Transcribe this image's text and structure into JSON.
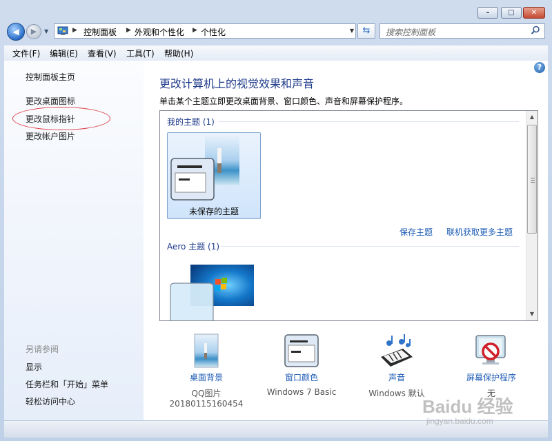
{
  "window": {
    "minimize_glyph": "–",
    "maximize_glyph": "□",
    "close_glyph": "✕"
  },
  "nav": {
    "back_glyph": "◀",
    "forward_glyph": "▶",
    "breadcrumbs": [
      "控制面板",
      "外观和个性化",
      "个性化"
    ],
    "search_placeholder": "搜索控制面板"
  },
  "menu": [
    "文件(F)",
    "编辑(E)",
    "查看(V)",
    "工具(T)",
    "帮助(H)"
  ],
  "sidebar": {
    "links": [
      "控制面板主页",
      "更改桌面图标",
      "更改鼠标指针",
      "更改帐户图片"
    ],
    "see_also_heading": "另请参阅",
    "see_also": [
      "显示",
      "任务栏和「开始」菜单",
      "轻松访问中心"
    ]
  },
  "main": {
    "title": "更改计算机上的视觉效果和声音",
    "subtitle": "单击某个主题立即更改桌面背景、窗口颜色、声音和屏幕保护程序。",
    "help_glyph": "?",
    "groups": [
      {
        "heading": "我的主题 (1)",
        "themes": [
          "未保存的主题"
        ]
      },
      {
        "heading": "Aero 主题 (1)",
        "themes": []
      }
    ],
    "actions": {
      "save": "保存主题",
      "online": "联机获取更多主题"
    }
  },
  "customizations": [
    {
      "label": "桌面背景",
      "value": "QQ图片",
      "value2": "20180115160454",
      "icon": "desktop-background-icon"
    },
    {
      "label": "窗口颜色",
      "value": "Windows 7 Basic",
      "icon": "window-color-icon"
    },
    {
      "label": "声音",
      "value": "Windows 默认",
      "icon": "sound-icon"
    },
    {
      "label": "屏幕保护程序",
      "value": "无",
      "icon": "screensaver-icon"
    }
  ],
  "watermark": {
    "line1": "Baidu 经验",
    "line2": "jingyan.baidu.com"
  },
  "colors": {
    "link": "#1c5bb5",
    "title": "#1e3a8a",
    "highlight_ellipse": "#e0414a"
  }
}
